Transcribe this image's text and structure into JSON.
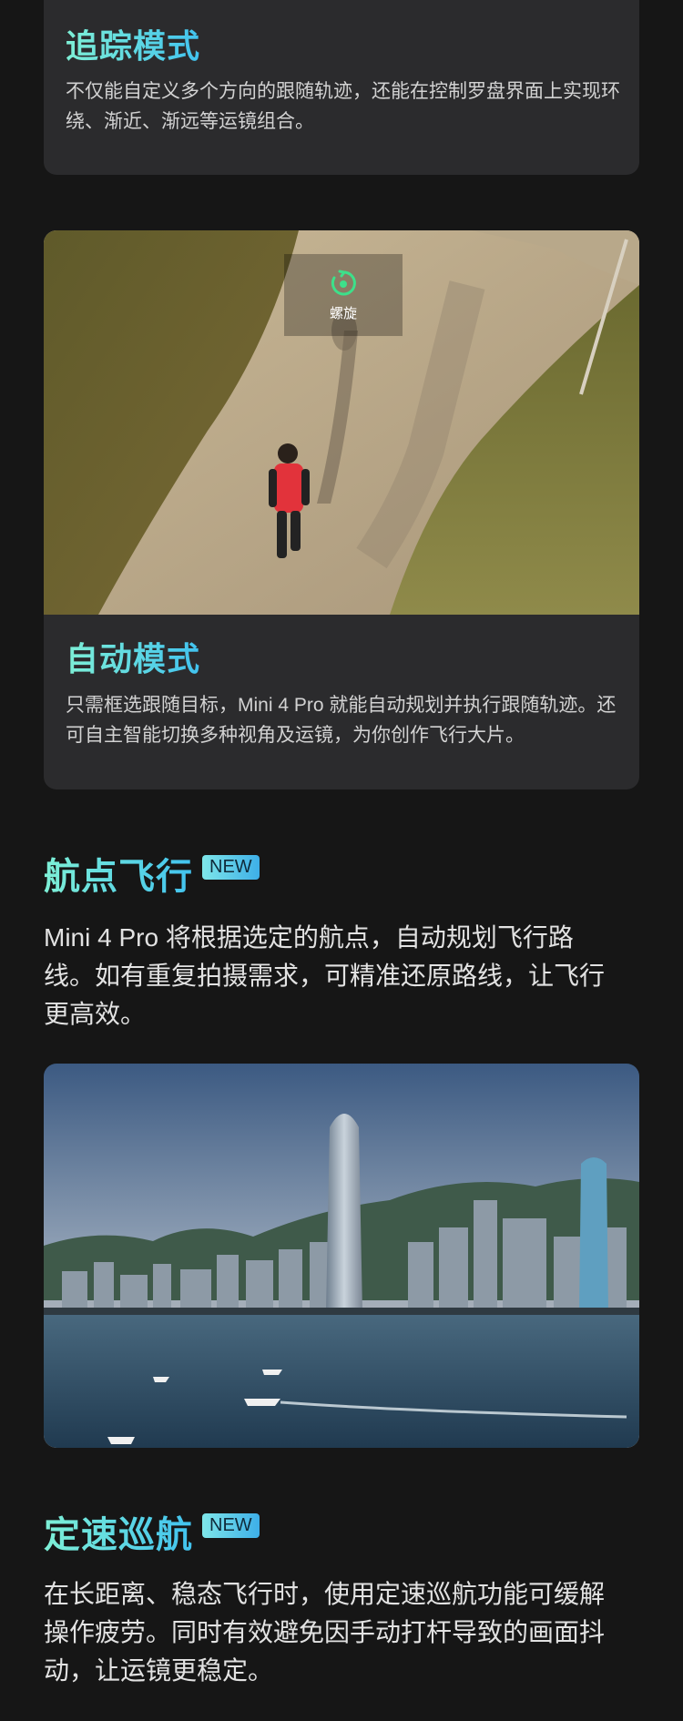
{
  "tracking_card": {
    "title": "追踪模式",
    "desc": "不仅能自定义多个方向的跟随轨迹，还能在控制罗盘界面上实现环绕、渐近、渐远等运镜组合。"
  },
  "auto_card": {
    "overlay_label": "螺旋",
    "title": "自动模式",
    "desc": "只需框选跟随目标，Mini 4 Pro 就能自动规划并执行跟随轨迹。还可自主智能切换多种视角及运镜，为你创作飞行大片。"
  },
  "waypoint": {
    "title": "航点飞行",
    "badge": "NEW",
    "desc": "Mini 4 Pro 将根据选定的航点，自动规划飞行路线。如有重复拍摄需求，可精准还原路线，让飞行更高效。"
  },
  "cruise": {
    "title": "定速巡航",
    "badge": "NEW",
    "desc": "在长距离、稳态飞行时，使用定速巡航功能可缓解操作疲劳。同时有效避免因手动打杆导致的画面抖动，让运镜更稳定。"
  },
  "colors": {
    "accent_start": "#7ef0d6",
    "accent_end": "#41c2ef",
    "background": "#161616",
    "card": "#2b2b2d"
  }
}
